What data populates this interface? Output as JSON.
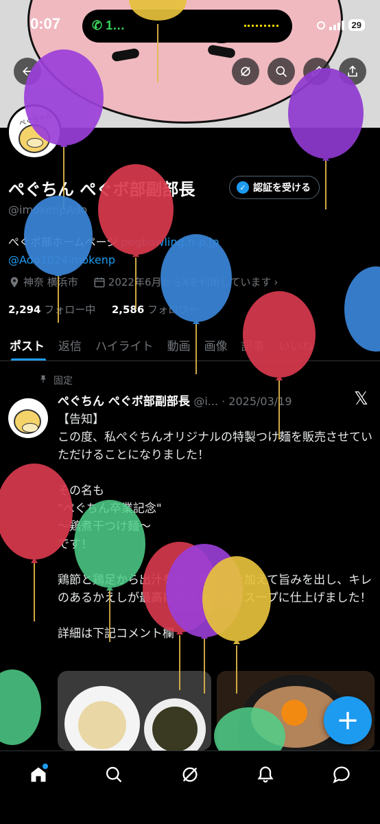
{
  "status_bar": {
    "time": "0:07",
    "call_indicator": "1…",
    "battery": "29"
  },
  "header": {
    "back_icon": "arrow-left-icon",
    "grok_icon": "grok-icon",
    "search_icon": "search-icon",
    "edit_icon": "pencil-icon",
    "share_icon": "share-icon"
  },
  "profile": {
    "display_name": "ぺぐちん ぺぐボ部副部長",
    "verify_button": "認証を受ける",
    "handle": "@imokenpAdo",
    "bio_text": "ぺぐボ部ホームページ ",
    "bio_link": "pegbowling.h-p.jp",
    "bio_mention": "@Ado1024imokenp",
    "location": "神奈 横浜市",
    "joined": "2022年6月からXを利用しています",
    "following_count": "2,294",
    "following_label": "フォロー中",
    "followers_count": "2,586",
    "followers_label": "フォロワー",
    "avatar_text": "ぺぐちゃん"
  },
  "tabs": [
    "ポスト",
    "返信",
    "ハイライト",
    "動画",
    "画像",
    "記事",
    "いいね"
  ],
  "post": {
    "pinned_label": "固定",
    "author": "ぺぐちん ぺぐボ部副部長",
    "meta": "@i... · 2025/03/19",
    "text": "【告知】\nこの度、私ぺぐちんオリジナルの特製つけ麺を販売させていただけることになりました！\n\nその名も\n\"ぺぐちん卒業記念\"\n〜鶏煮干つけ麺〜\nです！\n\n鶏節と鶏足から出汁を取り煮干しを加えて旨みを出し、キレのあるかえしが最高に生きる最高なスープに仕上げました！\n\n詳細は下記コメント欄"
  },
  "fab_label": "+",
  "colors": {
    "accent": "#1d9bf0",
    "background": "#000000",
    "muted": "#71767b"
  }
}
